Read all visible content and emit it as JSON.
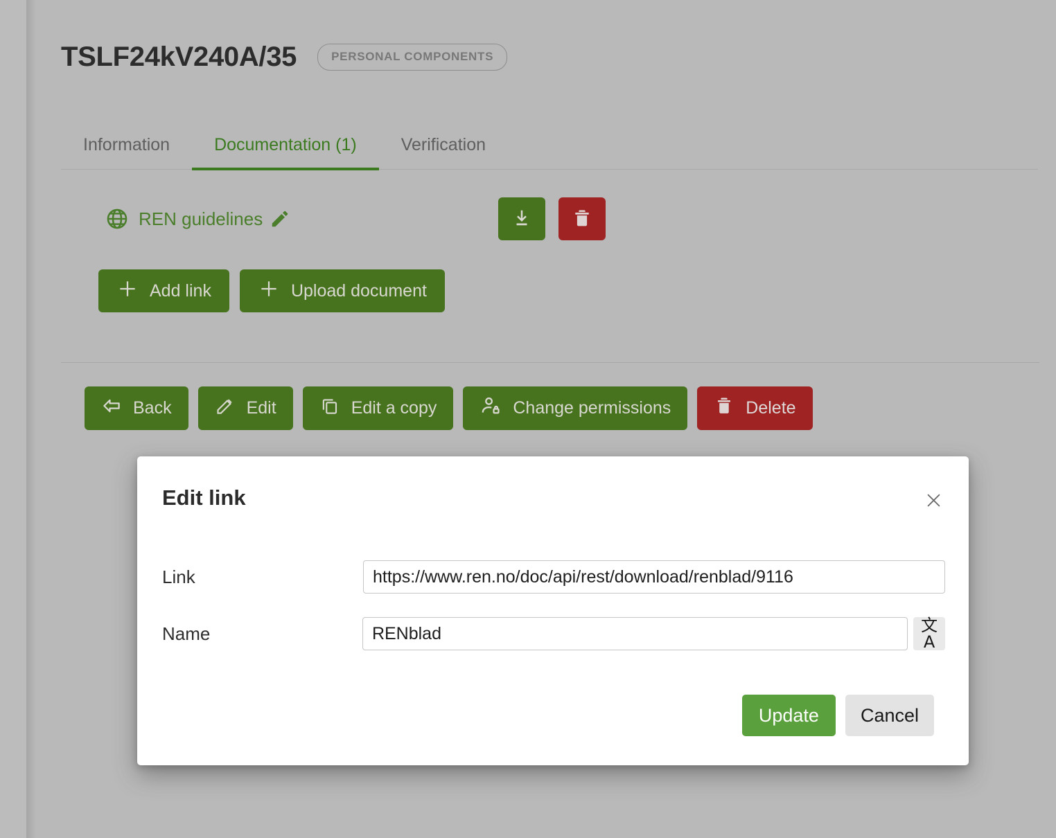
{
  "header": {
    "title": "TSLF24kV240A/35",
    "badge": "PERSONAL COMPONENTS"
  },
  "tabs": [
    {
      "label": "Information",
      "active": false
    },
    {
      "label": "Documentation (1)",
      "active": true
    },
    {
      "label": "Verification",
      "active": false
    }
  ],
  "documentation": {
    "item": {
      "icon": "globe-icon",
      "name": "REN guidelines",
      "edit_icon": "pencil-icon"
    },
    "row_actions": [
      {
        "name": "download-icon",
        "color": "#47731f"
      },
      {
        "name": "trash-icon",
        "color": "#9e2322"
      }
    ],
    "add_buttons": [
      {
        "label": "Add link",
        "icon": "plus-icon"
      },
      {
        "label": "Upload document",
        "icon": "plus-icon"
      }
    ]
  },
  "actions": [
    {
      "label": "Back",
      "icon": "arrow-left-icon",
      "style": "green"
    },
    {
      "label": "Edit",
      "icon": "pencil-icon",
      "style": "green"
    },
    {
      "label": "Edit a copy",
      "icon": "copy-icon",
      "style": "green"
    },
    {
      "label": "Change permissions",
      "icon": "person-lock-icon",
      "style": "green"
    },
    {
      "label": "Delete",
      "icon": "trash-icon",
      "style": "red"
    }
  ],
  "modal": {
    "title": "Edit link",
    "close_icon": "close-icon",
    "fields": {
      "link": {
        "label": "Link",
        "value": "https://www.ren.no/doc/api/rest/download/renblad/9116"
      },
      "name": {
        "label": "Name",
        "value": "RENblad",
        "translate_icon": "translate-icon",
        "translate_glyph": "文A"
      }
    },
    "buttons": {
      "update": "Update",
      "cancel": "Cancel"
    }
  },
  "colors": {
    "brand_green": "#47731f",
    "accent_green": "#5aa03c",
    "danger_red": "#9e2322",
    "tab_active": "#3c7a20",
    "link_green": "#4a7e2b",
    "page_background": "#b9b9b9"
  }
}
